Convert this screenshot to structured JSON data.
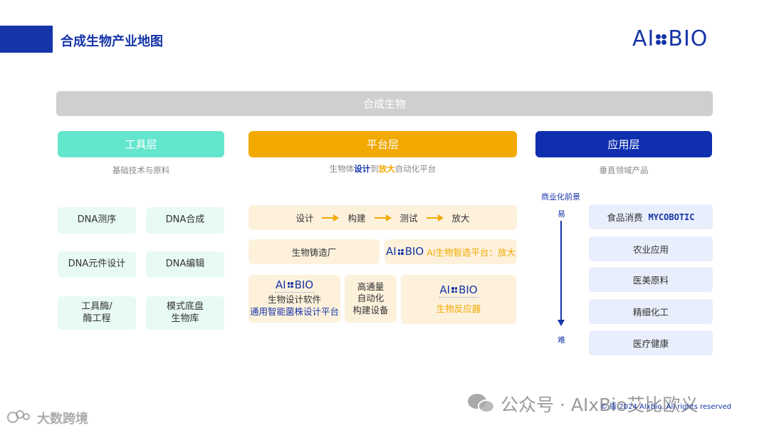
{
  "header": {
    "title": "合成生物产业地图",
    "logo": {
      "left": "AI",
      "right": "BIO",
      "icon": "x-dots-icon"
    }
  },
  "banner": "合成生物",
  "tool_layer": {
    "title": "工具层",
    "subtitle": "基础技术与原料",
    "items": [
      "DNA测序",
      "DNA合成",
      "DNA元件设计",
      "DNA编辑",
      "工具酶/\n酶工程",
      "模式底盘\n生物库"
    ]
  },
  "platform_layer": {
    "title": "平台层",
    "subtitle": {
      "p1": "生物体",
      "p2": "设计",
      "p3": "到",
      "p4": "放大",
      "p5": "自动化平台"
    },
    "flow": [
      "设计",
      "构建",
      "测试",
      "放大"
    ],
    "foundry": "生物铸造厂",
    "ai_platform": "AI生物智造平台：放大",
    "design_software": {
      "line1": "生物设计软件",
      "line2": "通用智能菌株设计平台"
    },
    "high_throughput": "高通量\n自动化\n构建设备",
    "bioreactor": "生物反应器",
    "logo": {
      "left": "AI",
      "right": "BIO"
    }
  },
  "application_layer": {
    "title": "应用层",
    "subtitle": "垂直领域产品",
    "axis": {
      "label": "商业化前景",
      "top": "易",
      "bottom": "难"
    },
    "items": [
      "食品消费",
      "农业应用",
      "医美原料",
      "精细化工",
      "医疗健康"
    ],
    "food_brand": "MYCOBOTIC"
  },
  "watermark": {
    "wechat": "公众号 · AIxBio艾比欧义",
    "copyright": "© 版 2024 AIxBio. All rights reserved",
    "corner": "大数跨境"
  },
  "colors": {
    "brand_blue": "#1534a8",
    "tool_teal": "#63e6cc",
    "platform_orange": "#f2a900",
    "app_blue": "#0f2fb0",
    "banner_gray": "#cfcfcf"
  }
}
